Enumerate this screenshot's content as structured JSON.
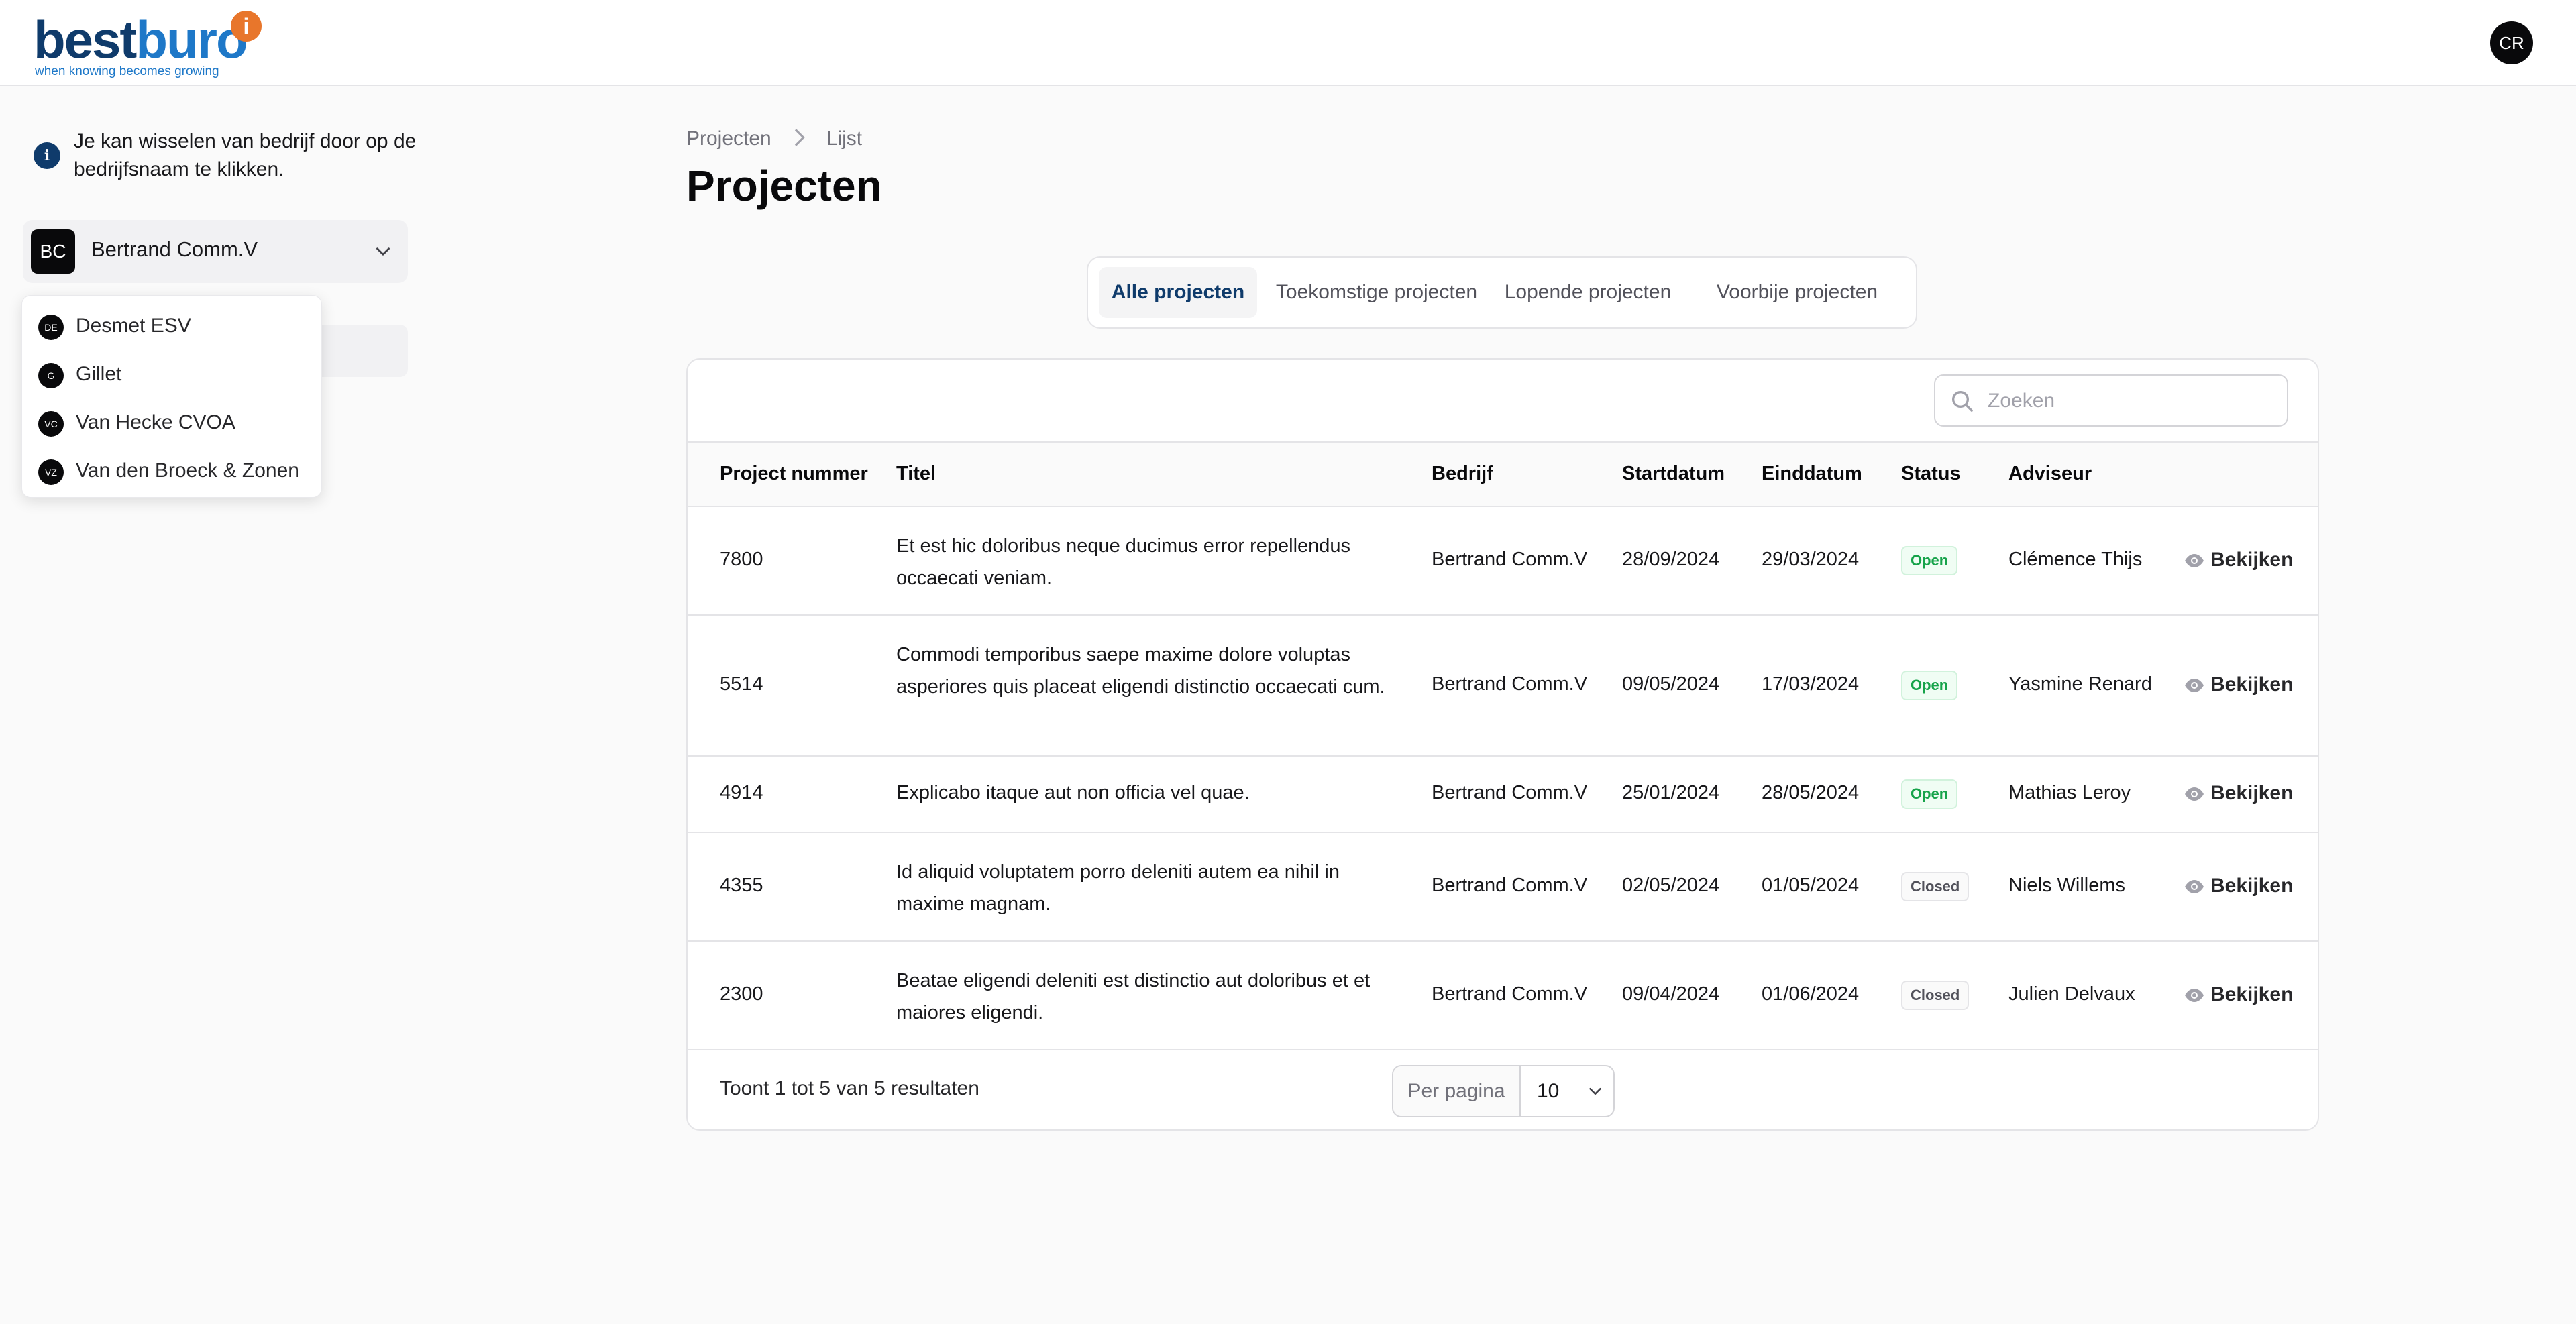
{
  "brand": {
    "name_part1": "best",
    "name_part2": "buro",
    "mark": "i",
    "tagline": "when knowing becomes growing"
  },
  "user": {
    "initials": "CR"
  },
  "sidebar": {
    "info_text": "Je kan wisselen van bedrijf door op de bedrijfsnaam te klikken.",
    "selected_company": {
      "initials": "BC",
      "name": "Bertrand Comm.V"
    },
    "dropdown_items": [
      {
        "initials": "DE",
        "name": "Desmet ESV"
      },
      {
        "initials": "G",
        "name": "Gillet"
      },
      {
        "initials": "VC",
        "name": "Van Hecke CVOA"
      },
      {
        "initials": "VZ",
        "name": "Van den Broeck & Zonen"
      }
    ]
  },
  "breadcrumb": {
    "root": "Projecten",
    "current": "Lijst"
  },
  "page_title": "Projecten",
  "tabs": [
    "Alle projecten",
    "Toekomstige projecten",
    "Lopende projecten",
    "Voorbije projecten"
  ],
  "active_tab": "Alle projecten",
  "search": {
    "placeholder": "Zoeken",
    "value": ""
  },
  "table": {
    "headers": [
      "Project nummer",
      "Titel",
      "Bedrijf",
      "Startdatum",
      "Einddatum",
      "Status",
      "Adviseur"
    ],
    "view_label": "Bekijken",
    "rows": [
      {
        "number": "7800",
        "title": "Et est hic doloribus neque ducimus error repellendus occaecati veniam.",
        "company": "Bertrand Comm.V",
        "start": "28/09/2024",
        "end": "29/03/2024",
        "status": "Open",
        "advisor": "Clémence Thijs"
      },
      {
        "number": "5514",
        "title": "Commodi temporibus saepe maxime dolore voluptas asperiores quis placeat eligendi distinctio occaecati cum.",
        "company": "Bertrand Comm.V",
        "start": "09/05/2024",
        "end": "17/03/2024",
        "status": "Open",
        "advisor": "Yasmine Renard"
      },
      {
        "number": "4914",
        "title": "Explicabo itaque aut non officia vel quae.",
        "company": "Bertrand Comm.V",
        "start": "25/01/2024",
        "end": "28/05/2024",
        "status": "Open",
        "advisor": "Mathias Leroy"
      },
      {
        "number": "4355",
        "title": "Id aliquid voluptatem porro deleniti autem ea nihil in maxime magnam.",
        "company": "Bertrand Comm.V",
        "start": "02/05/2024",
        "end": "01/05/2024",
        "status": "Closed",
        "advisor": "Niels Willems"
      },
      {
        "number": "2300",
        "title": "Beatae eligendi deleniti est distinctio aut doloribus et et maiores eligendi.",
        "company": "Bertrand Comm.V",
        "start": "09/04/2024",
        "end": "01/06/2024",
        "status": "Closed",
        "advisor": "Julien Delvaux"
      }
    ]
  },
  "footer": {
    "results_text": "Toont 1 tot 5 van 5 resultaten",
    "per_page_label": "Per pagina",
    "per_page_value": "10"
  },
  "colors": {
    "brand_dark": "#0f3b6b",
    "brand_blue": "#1e78c8",
    "brand_orange": "#e8762b",
    "open_green": "#16a34a"
  }
}
